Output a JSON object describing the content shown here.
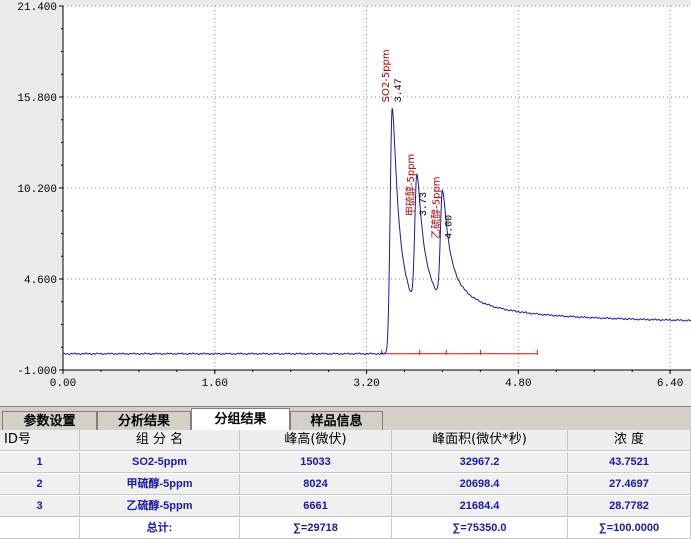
{
  "chart_data": {
    "type": "line",
    "x_ticks": [
      "0.00",
      "1.60",
      "3.20",
      "4.80",
      "6.40"
    ],
    "y_ticks": [
      "21.400",
      "15.800",
      "10.200",
      "4.600",
      "-1.000"
    ],
    "xlim": [
      0,
      6.62
    ],
    "ylim": [
      -1.0,
      21.4
    ],
    "grid": true,
    "baseline": 0.0,
    "peaks": [
      {
        "name": "SO2-5ppm",
        "time": 3.47,
        "time_label": "3.47",
        "height": 15.1,
        "width": 0.035
      },
      {
        "name": "甲硫醇-5ppm",
        "time": 3.73,
        "time_label": "3.73",
        "height": 8.1,
        "width": 0.035
      },
      {
        "name": "乙硫醇-5ppm",
        "time": 4.0,
        "time_label": "4.00",
        "height": 6.7,
        "width": 0.035
      }
    ],
    "integration_markers": [
      3.36,
      3.76,
      4.04,
      4.4,
      5.0
    ],
    "colors": {
      "trace": "#1a1aa8",
      "baseline": "#ff0000",
      "label": "#b00000",
      "grid": "#888888"
    }
  },
  "tabs": [
    {
      "label": "参数设置",
      "active": false
    },
    {
      "label": "分析结果",
      "active": false
    },
    {
      "label": "分组结果",
      "active": true
    },
    {
      "label": "样品信息",
      "active": false
    }
  ],
  "table": {
    "headers": [
      "ID号",
      "组 分 名",
      "峰高(微伏)",
      "峰面积(微伏*秒)",
      "浓    度"
    ],
    "rows": [
      [
        "1",
        "SO2-5ppm",
        "15033",
        "32967.2",
        "43.7521"
      ],
      [
        "2",
        "甲硫醇-5ppm",
        "8024",
        "20698.4",
        "27.4697"
      ],
      [
        "3",
        "乙硫醇-5ppm",
        "6661",
        "21684.4",
        "28.7782"
      ]
    ],
    "totals": [
      "",
      "总计:",
      "∑=29718",
      "∑=75350.0",
      "∑=100.0000"
    ]
  }
}
